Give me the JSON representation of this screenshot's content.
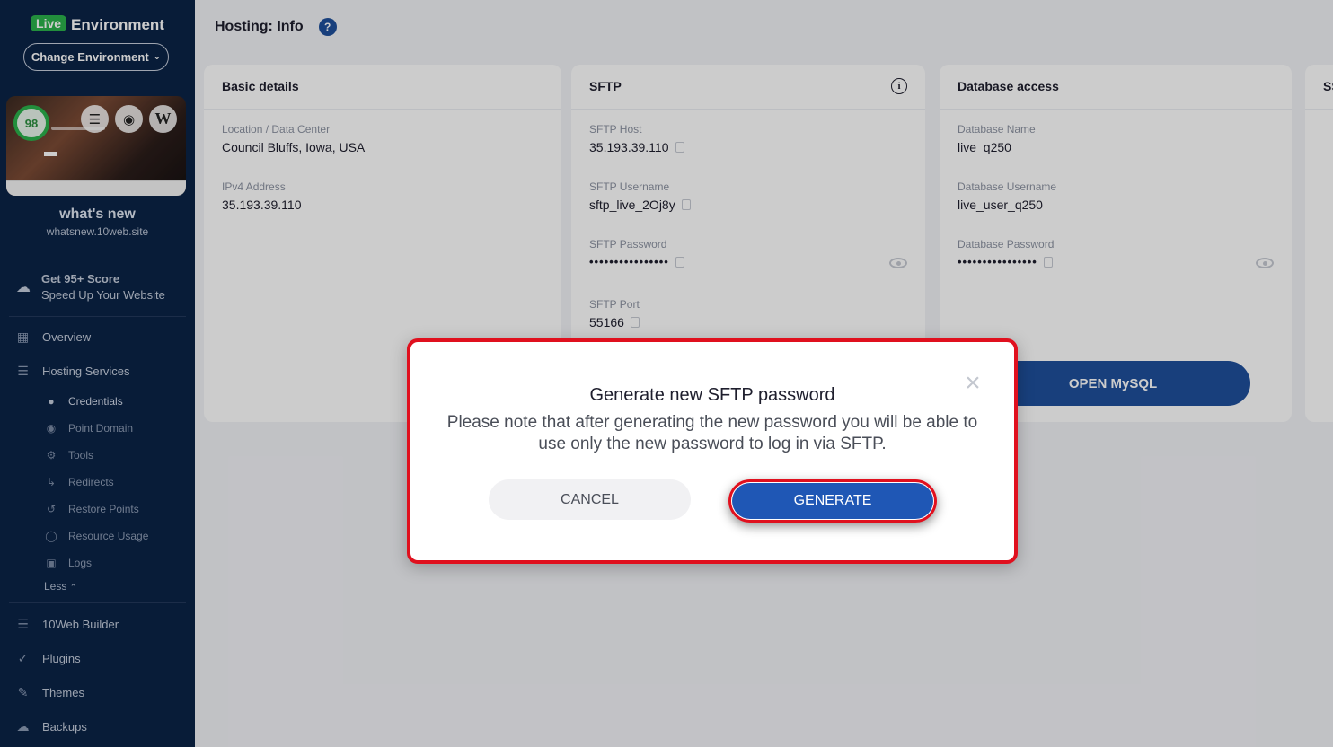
{
  "sidebar": {
    "env_badge": "Live",
    "env_title": "Environment",
    "change_env_label": "Change Environment",
    "score": "98",
    "site_name": "what's new",
    "site_url": "whatsnew.10web.site",
    "promo": {
      "line1": "Get 95+ Score",
      "line2": "Speed Up Your Website"
    },
    "nav": {
      "overview": "Overview",
      "hosting_services": "Hosting Services",
      "sub_items": [
        "Credentials",
        "Point Domain",
        "Tools",
        "Redirects",
        "Restore Points",
        "Resource Usage",
        "Logs"
      ],
      "less": "Less",
      "builder": "10Web Builder",
      "plugins": "Plugins",
      "themes": "Themes",
      "backups": "Backups"
    }
  },
  "main": {
    "page_title": "Hosting: Info",
    "basic": {
      "title": "Basic details",
      "location_label": "Location / Data Center",
      "location_value": "Council Bluffs, Iowa, USA",
      "ipv4_label": "IPv4 Address",
      "ipv4_value": "35.193.39.110"
    },
    "sftp": {
      "title": "SFTP",
      "host_label": "SFTP Host",
      "host_value": "35.193.39.110",
      "username_label": "SFTP Username",
      "username_value": "sftp_live_2Oj8y",
      "password_label": "SFTP Password",
      "password_value": "••••••••••••••••",
      "port_label": "SFTP Port",
      "port_value": "55166"
    },
    "db": {
      "title": "Database access",
      "name_label": "Database Name",
      "name_value": "live_q250",
      "username_label": "Database Username",
      "username_value": "live_user_q250",
      "password_label": "Database Password",
      "password_value": "••••••••••••••••",
      "open_mysql": "OPEN MySQL"
    },
    "partial_card_title": "SS"
  },
  "modal": {
    "title": "Generate new SFTP password",
    "text": "Please note that after generating the new password you will be able to use only the new password to log in via SFTP.",
    "cancel": "CANCEL",
    "generate": "GENERATE",
    "close": "×"
  },
  "colors": {
    "sidebar_bg": "#0b2347",
    "live_green": "#2bb24c",
    "primary_blue": "#1f4f9b",
    "highlight_red": "#e0101e"
  }
}
